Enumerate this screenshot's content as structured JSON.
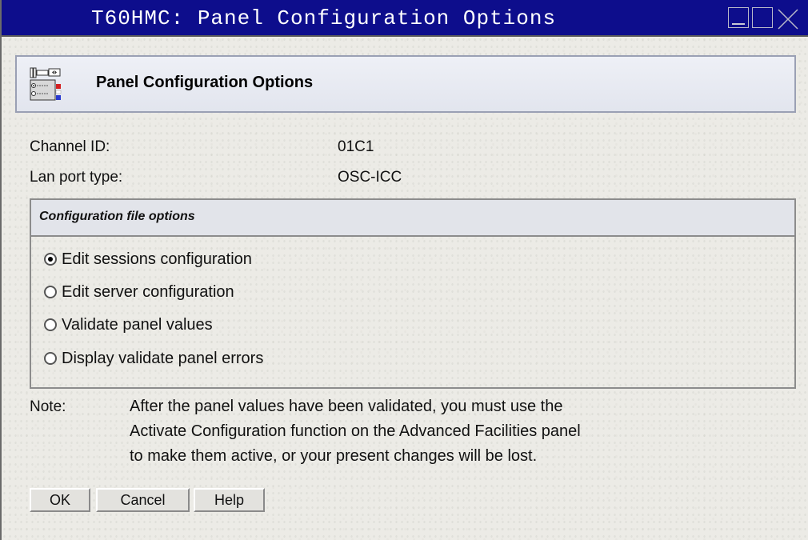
{
  "window": {
    "title": "T60HMC: Panel Configuration Options",
    "controls": [
      "minimize",
      "maximize",
      "close"
    ]
  },
  "header": {
    "icon": "panel-config-icon",
    "title": "Panel Configuration Options"
  },
  "info": {
    "channel_id_label": "Channel ID:",
    "channel_id_value": "01C1",
    "lan_port_label": "Lan port type:",
    "lan_port_value": "OSC-ICC"
  },
  "config_options": {
    "title": "Configuration file options",
    "options": [
      {
        "label": "Edit sessions configuration",
        "selected": true
      },
      {
        "label": "Edit server configuration",
        "selected": false
      },
      {
        "label": "Validate panel values",
        "selected": false
      },
      {
        "label": "Display validate panel errors",
        "selected": false
      }
    ]
  },
  "note": {
    "label": "Note:",
    "lines": [
      "After the panel values have been validated, you must use the",
      "Activate Configuration function on the Advanced Facilities panel",
      "to make them active, or your present changes will be lost."
    ]
  },
  "buttons": {
    "ok": "OK",
    "cancel": "Cancel",
    "help": "Help"
  },
  "colors": {
    "titlebar": "#0d0d8c",
    "background": "#ecebe6"
  }
}
